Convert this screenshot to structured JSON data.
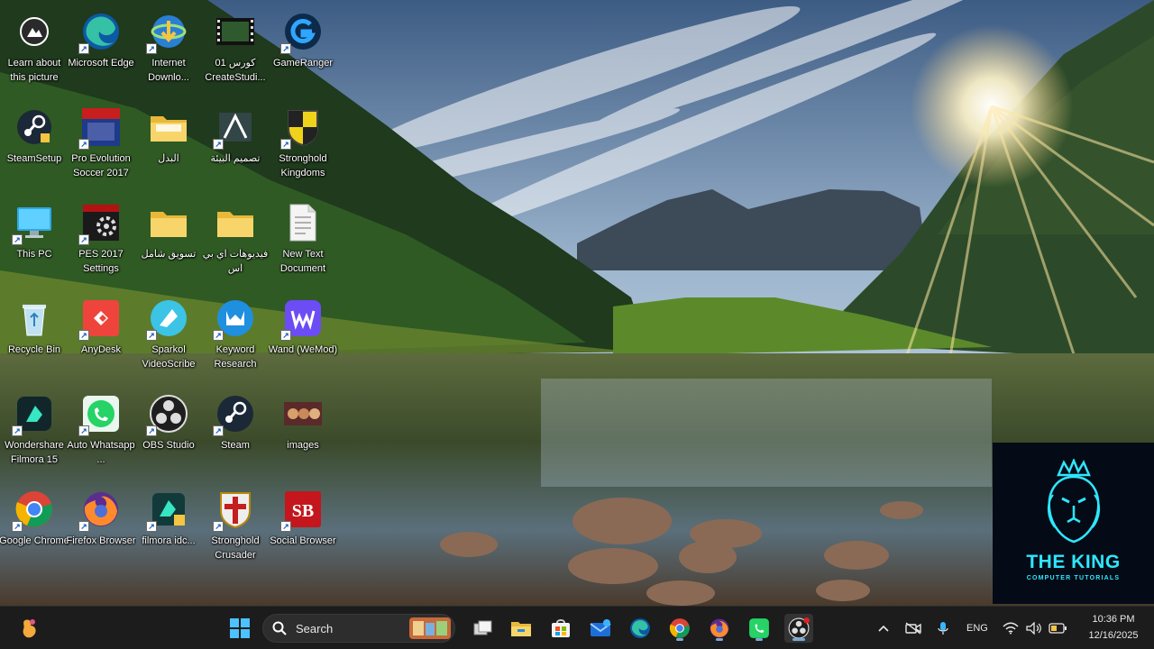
{
  "desktop": {
    "icons": [
      {
        "label": "Learn about this picture",
        "icon": "learn-about-picture-icon"
      },
      {
        "label": "Microsoft Edge",
        "icon": "edge-icon"
      },
      {
        "label": "Internet Downlo...",
        "icon": "internet-download-manager-icon"
      },
      {
        "label": "01 كورس CreateStudi...",
        "icon": "video-file-icon"
      },
      {
        "label": "GameRanger",
        "icon": "gameranger-icon"
      },
      {
        "label": "SteamSetup",
        "icon": "steam-setup-icon"
      },
      {
        "label": "Pro Evolution Soccer 2017",
        "icon": "pes-2017-icon"
      },
      {
        "label": "البدل",
        "icon": "folder-icon"
      },
      {
        "label": "تصميم البيئة",
        "icon": "design-shortcut-icon"
      },
      {
        "label": "Stronghold Kingdoms",
        "icon": "stronghold-kingdoms-icon"
      },
      {
        "label": "This PC",
        "icon": "this-pc-icon"
      },
      {
        "label": "PES 2017 Settings",
        "icon": "pes-settings-icon"
      },
      {
        "label": "تسويق شامل",
        "icon": "folder-icon"
      },
      {
        "label": "فيديوهات اي بي اس",
        "icon": "folder-icon"
      },
      {
        "label": "New Text Document",
        "icon": "text-document-icon"
      },
      {
        "label": "Recycle Bin",
        "icon": "recycle-bin-icon"
      },
      {
        "label": "AnyDesk",
        "icon": "anydesk-icon"
      },
      {
        "label": "Sparkol VideoScribe",
        "icon": "videoscribe-icon"
      },
      {
        "label": "Keyword Research",
        "icon": "keyword-research-icon"
      },
      {
        "label": "Wand (WeMod)",
        "icon": "wand-icon"
      },
      {
        "label": "Wondershare Filmora 15",
        "icon": "filmora-icon"
      },
      {
        "label": "Auto Whatsapp ...",
        "icon": "whatsapp-auto-icon"
      },
      {
        "label": "OBS Studio",
        "icon": "obs-icon"
      },
      {
        "label": "Steam",
        "icon": "steam-icon"
      },
      {
        "label": "images",
        "icon": "images-icon"
      },
      {
        "label": "Google Chrome",
        "icon": "chrome-icon"
      },
      {
        "label": "Firefox Browser",
        "icon": "firefox-icon"
      },
      {
        "label": "filmora idc...",
        "icon": "filmora-idc-icon"
      },
      {
        "label": "Stronghold Crusader",
        "icon": "stronghold-crusader-icon"
      },
      {
        "label": "Social Browser",
        "icon": "social-browser-icon"
      }
    ]
  },
  "watermark": {
    "title": "THE KING",
    "subtitle": "COMPUTER TUTORIALS",
    "color": "#2ee6ff"
  },
  "taskbar": {
    "search_placeholder": "Search",
    "pinned": [
      "start-icon",
      "search-icon",
      "task-view-icon",
      "file-explorer-icon",
      "microsoft-store-icon",
      "mail-icon",
      "edge-icon",
      "chrome-icon",
      "firefox-icon",
      "whatsapp-icon",
      "obs-icon"
    ],
    "tray": {
      "language": "ENG",
      "time": "10:36 PM",
      "date": "12/16/2025"
    }
  },
  "colors": {
    "taskbar_bg": "#1c1c1c",
    "accent": "#2ee6ff"
  }
}
